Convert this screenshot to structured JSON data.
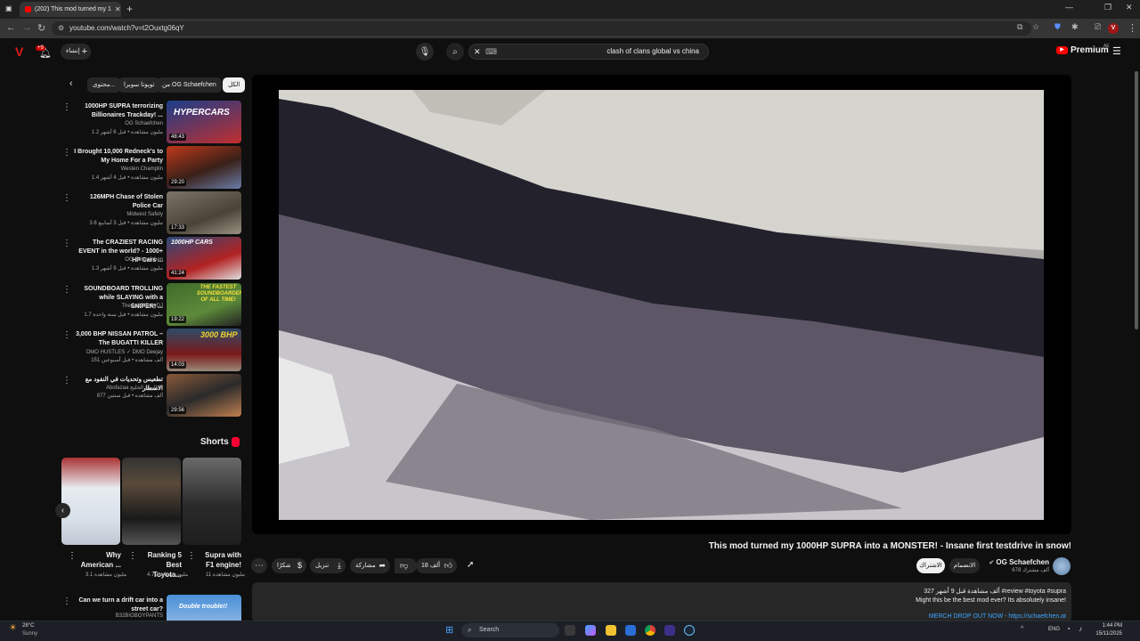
{
  "browser": {
    "tab_title": "(202) This mod turned my 1",
    "url": "youtube.com/watch?v=t2Ouxtg06qY",
    "new_tab_label": "+"
  },
  "header": {
    "notif_count": "+9",
    "create_label": "إنشاء",
    "search_value": "clash of clans global vs china",
    "premium_label": "Premium",
    "premium_region": "AE"
  },
  "chips": [
    {
      "label": "الكل"
    },
    {
      "label": "من OG Schaefchen"
    },
    {
      "label": "تويوتا سوبرا"
    },
    {
      "label": "محتوى..."
    }
  ],
  "recommendations": [
    {
      "title": "1000HP SUPRA terrorizing Billionaires Trackday! ...",
      "channel": "OG Schaefchen",
      "meta": "1.2 مليون مشاهدة • قبل 6 أشهر",
      "duration": "48:43",
      "thumb_text": "HYPERCARS",
      "thumb_color": "#1b3d8a"
    },
    {
      "title": "I Brought 10,000 Redneck's to My Home For a Party",
      "channel": "Westen Champlin",
      "meta": "1.4 مليون مشاهدة • قبل 4 أشهر",
      "duration": "29:20",
      "thumb_text": "",
      "thumb_color": "#5a3320"
    },
    {
      "title": "126MPH Chase of Stolen Police Car",
      "channel": "Midwest Safety",
      "meta": "3.6 مليون مشاهدة • قبل 3 أسابيع",
      "duration": "17:33",
      "thumb_text": "",
      "thumb_color": "#6b6458"
    },
    {
      "title": "The CRAZIEST RACING EVENT in the world? - 1000+ HP Cars ...",
      "channel": "OG Schaefchen",
      "meta": "1.3 مليون مشاهدة • قبل 9 أشهر",
      "duration": "41:24",
      "thumb_text": "1000HP CARS",
      "thumb_color": "#2a4a7a"
    },
    {
      "title": "SOUNDBOARD TROLLING while SLAYING with a SNIPER! ...",
      "channel": "TheCallOfDutyDJ",
      "meta": "1.7 مليون مشاهدة • قبل سنة واحدة",
      "duration": "19:22",
      "thumb_text": "THE FASTEST SOUNDBOARDER OF ALL TIME!",
      "thumb_color": "#3e6b2a"
    },
    {
      "title": "3,000 BHP NISSAN PATROL – The BUGATTI KILLER",
      "channel": "DMO HUSTLES ✓ DMO Deejay",
      "meta": "151 ألف مشاهدة • قبل أسبوعين",
      "duration": "14:03",
      "thumb_text": "3000 BHP",
      "thumb_color": "#2e4b68"
    },
    {
      "title": "تطعيس وتحديات في النفود مع الاسطار",
      "channel": "Abofazaa النهام الخليج ✓",
      "meta": "877 ألف مشاهدة • قبل سنتين",
      "duration": "29:56",
      "thumb_text": "",
      "thumb_color": "#8a5a3a"
    }
  ],
  "shorts": {
    "heading": "Shorts",
    "items": [
      {
        "title": "Supra with F1 engine!",
        "meta": "11 مليون مشاهدة",
        "color": "#444"
      },
      {
        "title": "Ranking 5 Best Toyota...",
        "meta": "4.7 مليون مشاهدة",
        "color": "#3a2a2a"
      },
      {
        "title": "Why American ...",
        "meta": "3.1 مليون مشاهدة",
        "color": "#cfd6de"
      }
    ]
  },
  "last_rec": {
    "title": "Can we turn a drift car into a street car?",
    "channel": "B32BIGBOYPANTS",
    "thumb_text": "Double trouble!!"
  },
  "video": {
    "title": "This mod turned my 1000HP SUPRA into a MONSTER! - Insane first testdrive in snow!",
    "channel": "OG Schaefchen",
    "subscribers": "678 ألف مشترك",
    "join_label": "الانضمام",
    "subscribe_label": "الاشتراك",
    "likes": "18 ألف",
    "share_label": "مشاركة",
    "download_label": "تنزيل",
    "thanks_label": "شكرًا",
    "description": {
      "line1": "327 ألف مشاهدة  قبل 9 أشهر  #review #toyota #supra",
      "line2": "Might this be the best mod ever? Its absolutely insane!",
      "line3": "MERCH DROP OUT NOW - https://schaefchen.at"
    }
  },
  "taskbar": {
    "weather_temp": "28°C",
    "weather_desc": "Sunny",
    "search_placeholder": "Search",
    "lang": "ENG",
    "time": "1:44 PM",
    "date": "15/11/2025"
  },
  "colors": {
    "brand_red": "#ff0000",
    "bg": "#0f0f0f",
    "chip": "#272727"
  }
}
